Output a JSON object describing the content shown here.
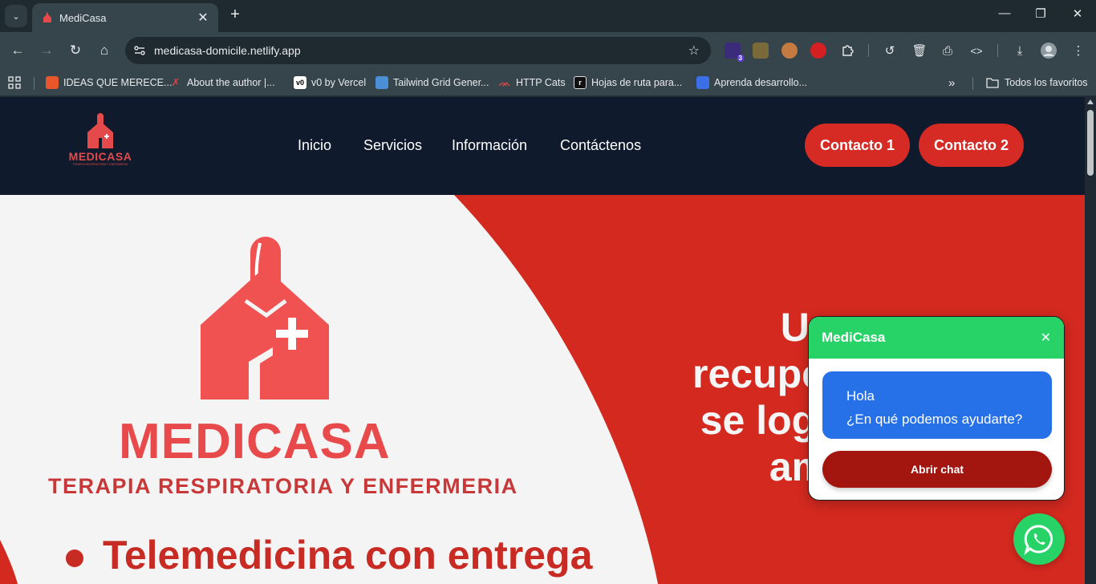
{
  "browser": {
    "tab": {
      "title": "MediCasa",
      "close_glyph": "✕"
    },
    "new_tab_glyph": "+",
    "tab_menu_glyph": "⌄",
    "window_controls": {
      "minimize": "—",
      "maximize": "❐",
      "close": "✕"
    },
    "nav": {
      "back": "←",
      "forward": "→",
      "reload": "↻",
      "home": "⌂"
    },
    "url": "medicasa-domicile.netlify.app",
    "star_glyph": "☆",
    "extensions": {
      "badge_count": "3"
    },
    "toolbar_icons": {
      "history": "↺",
      "delete": "🗑",
      "print": "⎙",
      "code": "<>",
      "download": "⤓",
      "menu": "⋮"
    },
    "bookmarks": [
      {
        "label": "IDEAS QUE MERECE...",
        "icon": "ted-icon",
        "color": "#e8562b"
      },
      {
        "label": "About the author |...",
        "icon": "author-icon",
        "color": "#c83737"
      },
      {
        "label": "v0 by Vercel",
        "icon": "v0-icon",
        "color": "#ffffff"
      },
      {
        "label": "Tailwind Grid Gener...",
        "icon": "tailwind-icon",
        "color": "#4b8fd6"
      },
      {
        "label": "HTTP Cats",
        "icon": "cat-icon",
        "color": "#d14b4b"
      },
      {
        "label": "Hojas de ruta para...",
        "icon": "roadmap-icon",
        "color": "#111111"
      },
      {
        "label": "Aprenda desarrollo...",
        "icon": "dev-icon",
        "color": "#3b6fe8"
      }
    ],
    "bookmarks_overflow": "»",
    "all_bookmarks": "Todos los favoritos"
  },
  "site": {
    "logo_text": "MEDICASA",
    "logo_sub": "TERAPIA RESPIRATORIA Y ENFERMERIA",
    "nav": [
      "Inicio",
      "Servicios",
      "Información",
      "Contáctenos"
    ],
    "cta": [
      "Contacto 1",
      "Contacto 2"
    ],
    "colors": {
      "header": "#0f1a2c",
      "brand_red": "#d62a24",
      "whatsapp_green": "#27d366",
      "chat_blue": "#2670e8"
    }
  },
  "hero": {
    "logo_text": "MEDICASA",
    "logo_sub": "TERAPIA RESPIRATORIA Y ENFERMERIA",
    "bullet_text": "Telemedicina con entrega",
    "headline_lines": [
      "Una",
      "recuperación",
      "se logra con",
      "amor"
    ]
  },
  "chat": {
    "title": "MediCasa",
    "close_glyph": "✕",
    "greeting": "Hola",
    "question": "¿En qué podemos ayudarte?",
    "button": "Abrir chat"
  }
}
